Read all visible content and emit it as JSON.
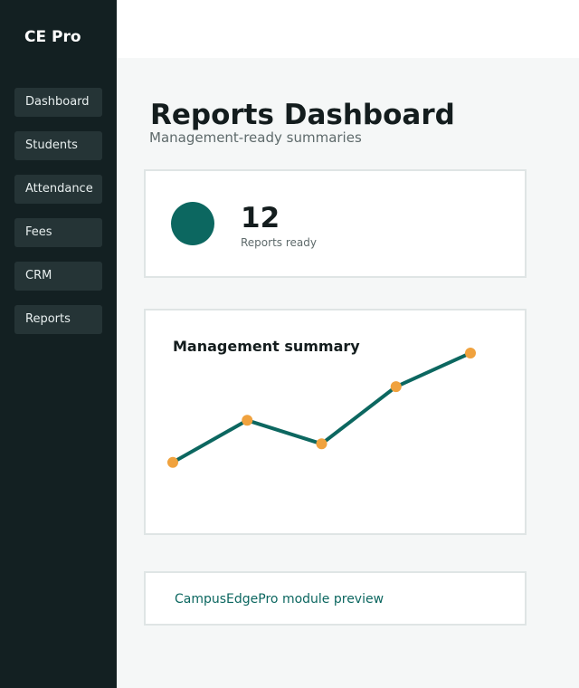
{
  "sidebar": {
    "brand": "CE Pro",
    "items": [
      {
        "label": "Dashboard"
      },
      {
        "label": "Students"
      },
      {
        "label": "Attendance"
      },
      {
        "label": "Fees"
      },
      {
        "label": "CRM"
      },
      {
        "label": "Reports"
      }
    ]
  },
  "header": {
    "title": "Reports Dashboard",
    "subtitle": "Management-ready summaries"
  },
  "stat": {
    "value": "12",
    "label": "Reports ready",
    "accent": "#0c6760"
  },
  "chart_data": {
    "type": "line",
    "title": "Management summary",
    "xlabel": "",
    "ylabel": "",
    "grid": false,
    "x": [
      1,
      2,
      3,
      4,
      5
    ],
    "series": [
      {
        "values": [
          10,
          60,
          32,
          100,
          140
        ]
      }
    ],
    "ylim": [
      0,
      140
    ],
    "line_color": "#0c6760",
    "marker_color": "#f0a23e"
  },
  "preview": {
    "link_text": "CampusEdgePro module preview"
  }
}
